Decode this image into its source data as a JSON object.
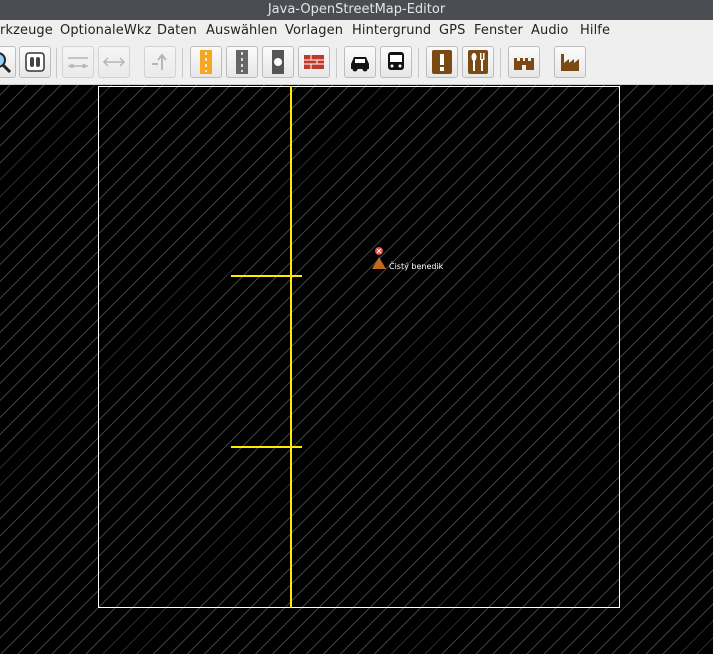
{
  "window": {
    "title": "Java-OpenStreetMap-Editor"
  },
  "menu": {
    "items": [
      "rkzeuge",
      "OptionaleWkz",
      "Daten",
      "Auswählen",
      "Vorlagen",
      "Hintergrund",
      "GPS",
      "Fenster",
      "Audio",
      "Hilfe"
    ]
  },
  "toolbar": {
    "buttons": [
      "zoom-icon",
      "select-mode-icon",
      "merge-nodes-icon",
      "split-way-icon",
      "reverse-way-icon",
      "road-primary-icon",
      "road-residential-icon",
      "road-track-icon",
      "wall-icon",
      "car-icon",
      "bus-icon",
      "warning-icon",
      "restaurant-icon",
      "castle-icon",
      "industrial-icon"
    ]
  },
  "map": {
    "poi_label": "Čistý benedik"
  },
  "colors": {
    "way": "#ffea00",
    "bounds": "#ffffff",
    "background": "#000000"
  }
}
